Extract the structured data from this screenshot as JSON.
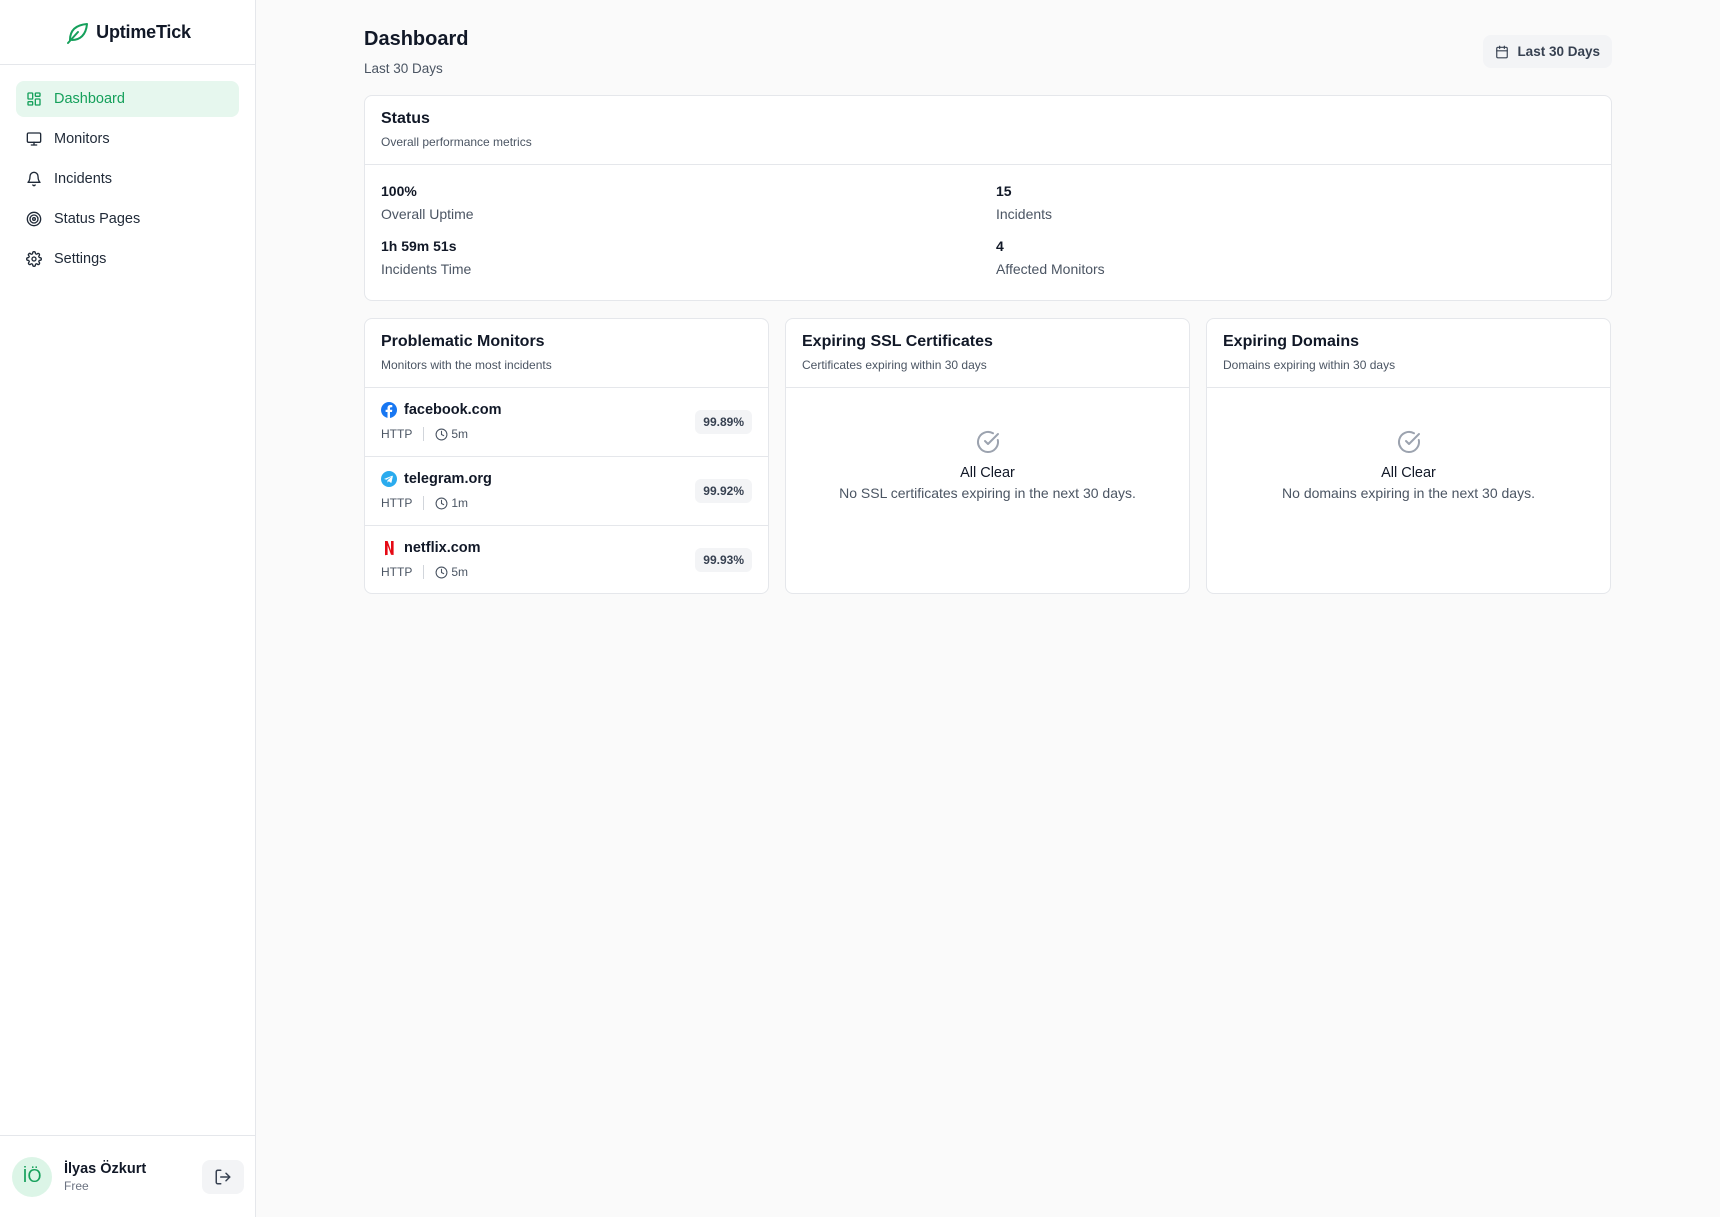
{
  "brand": {
    "name": "UptimeTick",
    "accent": "#15a05b"
  },
  "sidebar": {
    "items": [
      {
        "label": "Dashboard",
        "icon": "layout-dashboard-icon",
        "active": true
      },
      {
        "label": "Monitors",
        "icon": "monitor-icon"
      },
      {
        "label": "Incidents",
        "icon": "bell-icon"
      },
      {
        "label": "Status Pages",
        "icon": "radar-icon"
      },
      {
        "label": "Settings",
        "icon": "gear-icon"
      }
    ]
  },
  "user": {
    "initials": "İÖ",
    "name": "İlyas Özkurt",
    "plan": "Free"
  },
  "header": {
    "title": "Dashboard",
    "subtitle": "Last 30 Days",
    "range_button": "Last 30 Days"
  },
  "status": {
    "title": "Status",
    "description": "Overall performance metrics",
    "metrics": [
      {
        "value": "100%",
        "label": "Overall Uptime"
      },
      {
        "value": "15",
        "label": "Incidents"
      },
      {
        "value": "1h 59m 51s",
        "label": "Incidents Time"
      },
      {
        "value": "4",
        "label": "Affected Monitors"
      }
    ]
  },
  "problematic": {
    "title": "Problematic Monitors",
    "description": "Monitors with the most incidents",
    "monitors": [
      {
        "name": "facebook.com",
        "type": "HTTP",
        "interval": "5m",
        "uptime": "99.89%",
        "icon": "facebook-icon"
      },
      {
        "name": "telegram.org",
        "type": "HTTP",
        "interval": "1m",
        "uptime": "99.92%",
        "icon": "telegram-icon"
      },
      {
        "name": "netflix.com",
        "type": "HTTP",
        "interval": "5m",
        "uptime": "99.93%",
        "icon": "netflix-icon"
      }
    ]
  },
  "ssl": {
    "title": "Expiring SSL Certificates",
    "description": "Certificates expiring within 30 days",
    "empty_title": "All Clear",
    "empty_text": "No SSL certificates expiring in the next 30 days."
  },
  "domains": {
    "title": "Expiring Domains",
    "description": "Domains expiring within 30 days",
    "empty_title": "All Clear",
    "empty_text": "No domains expiring in the next 30 days."
  }
}
